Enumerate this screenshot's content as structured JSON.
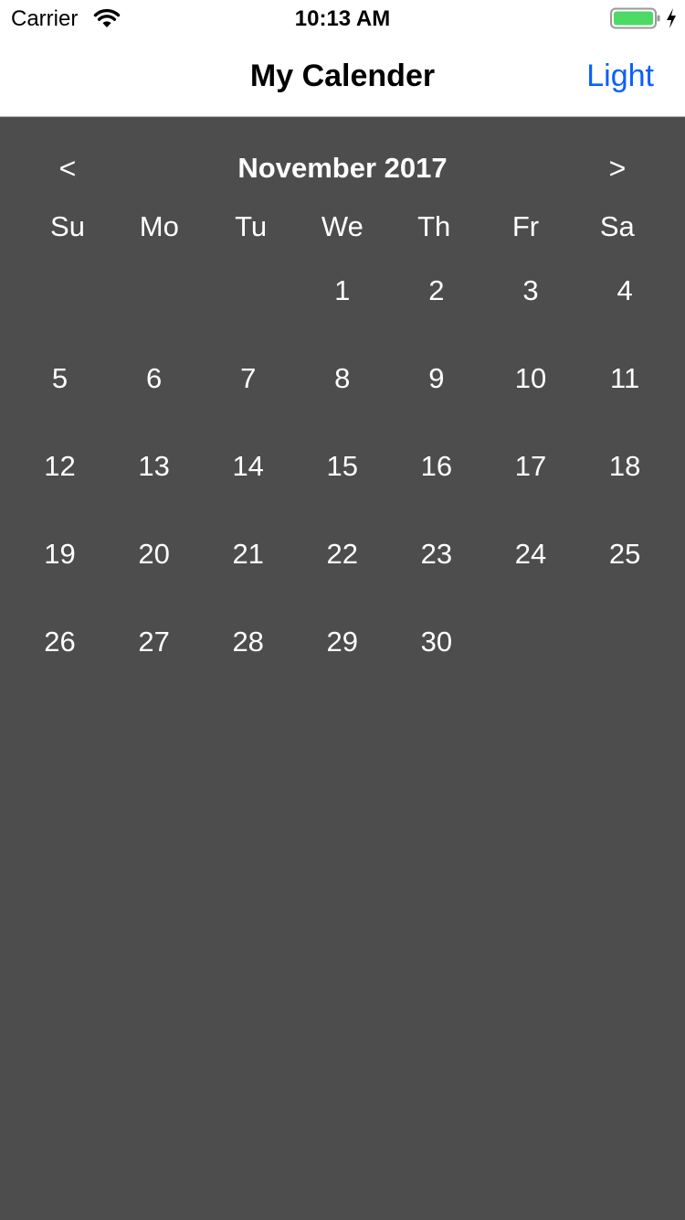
{
  "status_bar": {
    "carrier": "Carrier",
    "time": "10:13 AM",
    "wifi_icon": "wifi-icon",
    "battery_icon": "battery-icon",
    "charging_icon": "charging-bolt-icon",
    "battery_color": "#4cd964"
  },
  "nav": {
    "title": "My Calender",
    "right_button": "Light",
    "accent_color": "#0a60fe"
  },
  "calendar": {
    "background": "#4e4d4e",
    "prev_label": "<",
    "next_label": ">",
    "month_title": "November 2017",
    "weekdays": [
      "Su",
      "Mo",
      "Tu",
      "We",
      "Th",
      "Fr",
      "Sa"
    ],
    "first_weekday_index": 3,
    "days": [
      "1",
      "2",
      "3",
      "4",
      "5",
      "6",
      "7",
      "8",
      "9",
      "10",
      "11",
      "12",
      "13",
      "14",
      "15",
      "16",
      "17",
      "18",
      "19",
      "20",
      "21",
      "22",
      "23",
      "24",
      "25",
      "26",
      "27",
      "28",
      "29",
      "30"
    ]
  }
}
